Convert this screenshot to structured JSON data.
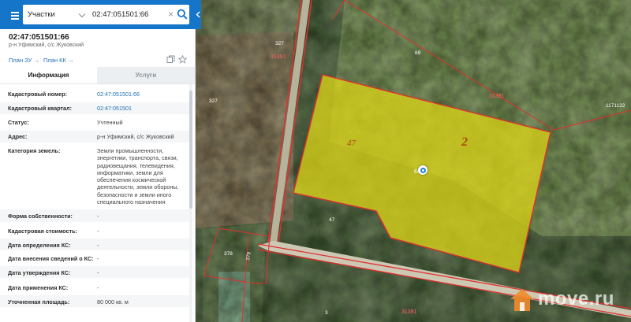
{
  "search": {
    "layer": "Участки",
    "query": "02:47:051501:66"
  },
  "object": {
    "cadastral_number": "02:47:051501:66",
    "subtitle": "р-н Уфимский, с/с Жуковский"
  },
  "links": {
    "plan_zu": "План ЗУ →",
    "plan_kk": "План КК →"
  },
  "tabs": {
    "info": "Информация",
    "services": "Услуги"
  },
  "info_rows": [
    {
      "label": "Кадастровый номер:",
      "value": "02:47:051501:66"
    },
    {
      "label": "Кадастровый квартал:",
      "value": "02:47:051501"
    },
    {
      "label": "Статус:",
      "value": "Учтенный"
    },
    {
      "label": "Адрес:",
      "value": "р-н Уфимский, с/с Жуковский"
    },
    {
      "label": "Категория земель:",
      "value": "Земли промышленности, энергетики, транспорта, связи, радиовещания, телевидения, информатики, земли для обеспечения космической деятельности, земли обороны, безопасности и земли иного специального назначения"
    },
    {
      "label": "Форма собственности:",
      "value": "-"
    },
    {
      "label": "Кадастровая стоимость:",
      "value": "-"
    },
    {
      "label": "Дата определения КС:",
      "value": "-"
    },
    {
      "label": "Дата внесения сведений о КС:",
      "value": "-"
    },
    {
      "label": "Дата утверждения КС:",
      "value": "-"
    },
    {
      "label": "Дата применения КС:",
      "value": "-"
    },
    {
      "label": "Уточненная площадь:",
      "value": "80 000 кв. м"
    }
  ],
  "map": {
    "parcel_labels": [
      "47",
      "2",
      "66"
    ],
    "labels": [
      "327",
      "31391",
      "69",
      "1171122",
      "327",
      "31391",
      "47",
      "378",
      "379",
      "3",
      "31391"
    ],
    "watermark": "move.ru",
    "colors": {
      "parcel_fill": "#d8d218",
      "boundary": "#e0302f",
      "label": "#ffffff",
      "marker": "#1d7fd6"
    }
  }
}
